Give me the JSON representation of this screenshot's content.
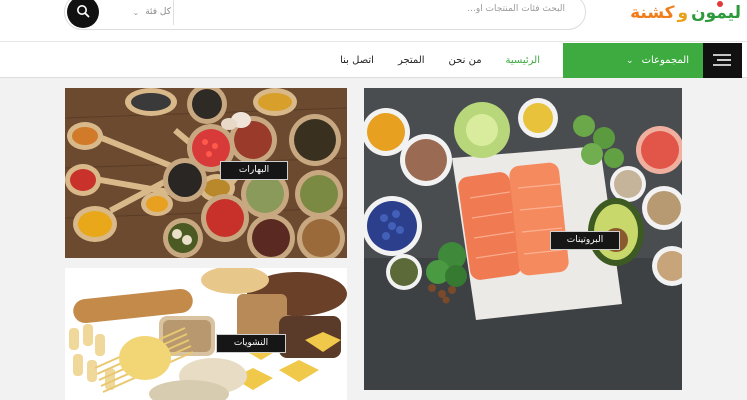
{
  "header": {
    "logo": {
      "word1": "ليمون",
      "word2": "و",
      "word3": "كشنة"
    },
    "search": {
      "placeholder": "البحث فئات المنتجات أو...",
      "category_value": "كل فئة",
      "chevron_icon": "chevron-down-icon",
      "button_icon": "search-icon"
    }
  },
  "nav": {
    "menu_icon": "hamburger-menu-icon",
    "categories_label": "المجموعات",
    "links": [
      {
        "label": "الرئيسية",
        "active": true
      },
      {
        "label": "من نحن",
        "active": false
      },
      {
        "label": "المتجر",
        "active": false
      },
      {
        "label": "اتصل بنا",
        "active": false
      }
    ]
  },
  "tiles": [
    {
      "label": "البروتينات"
    },
    {
      "label": "البهارات"
    },
    {
      "label": "النشويات"
    }
  ],
  "colors": {
    "accent_green": "#3dab3f",
    "dark": "#111111",
    "background": "#f2f2f2"
  }
}
